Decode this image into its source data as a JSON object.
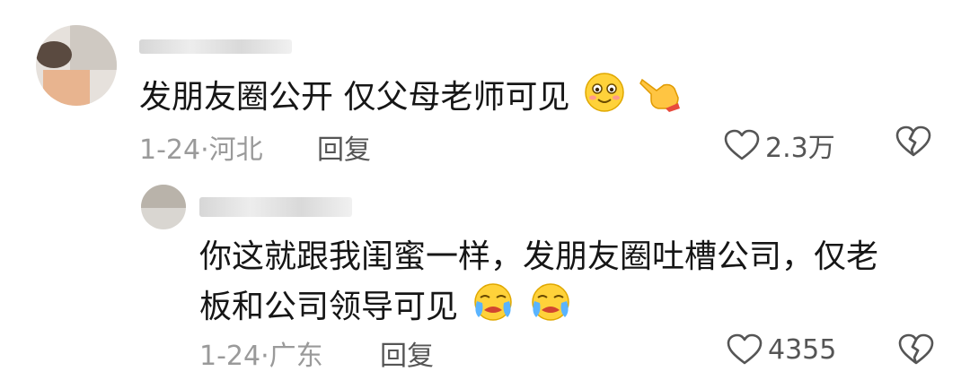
{
  "comments": [
    {
      "text": "发朋友圈公开  仅父母老师可见",
      "emojis": [
        "smiling-face-emoji",
        "pointing-hand-emoji"
      ],
      "date": "1-24",
      "location": "河北",
      "reply_label": "回复",
      "likes": "2.3万"
    },
    {
      "text_line1": "你这就跟我闺蜜一样，发朋友圈吐槽公司，仅老",
      "text_line2": "板和公司领导可见",
      "emojis": [
        "crying-face-emoji",
        "crying-face-emoji"
      ],
      "date": "1-24",
      "location": "广东",
      "reply_label": "回复",
      "likes": "4355"
    }
  ],
  "colors": {
    "text": "#161616",
    "meta": "#9a9a9a",
    "icon": "#555555"
  }
}
